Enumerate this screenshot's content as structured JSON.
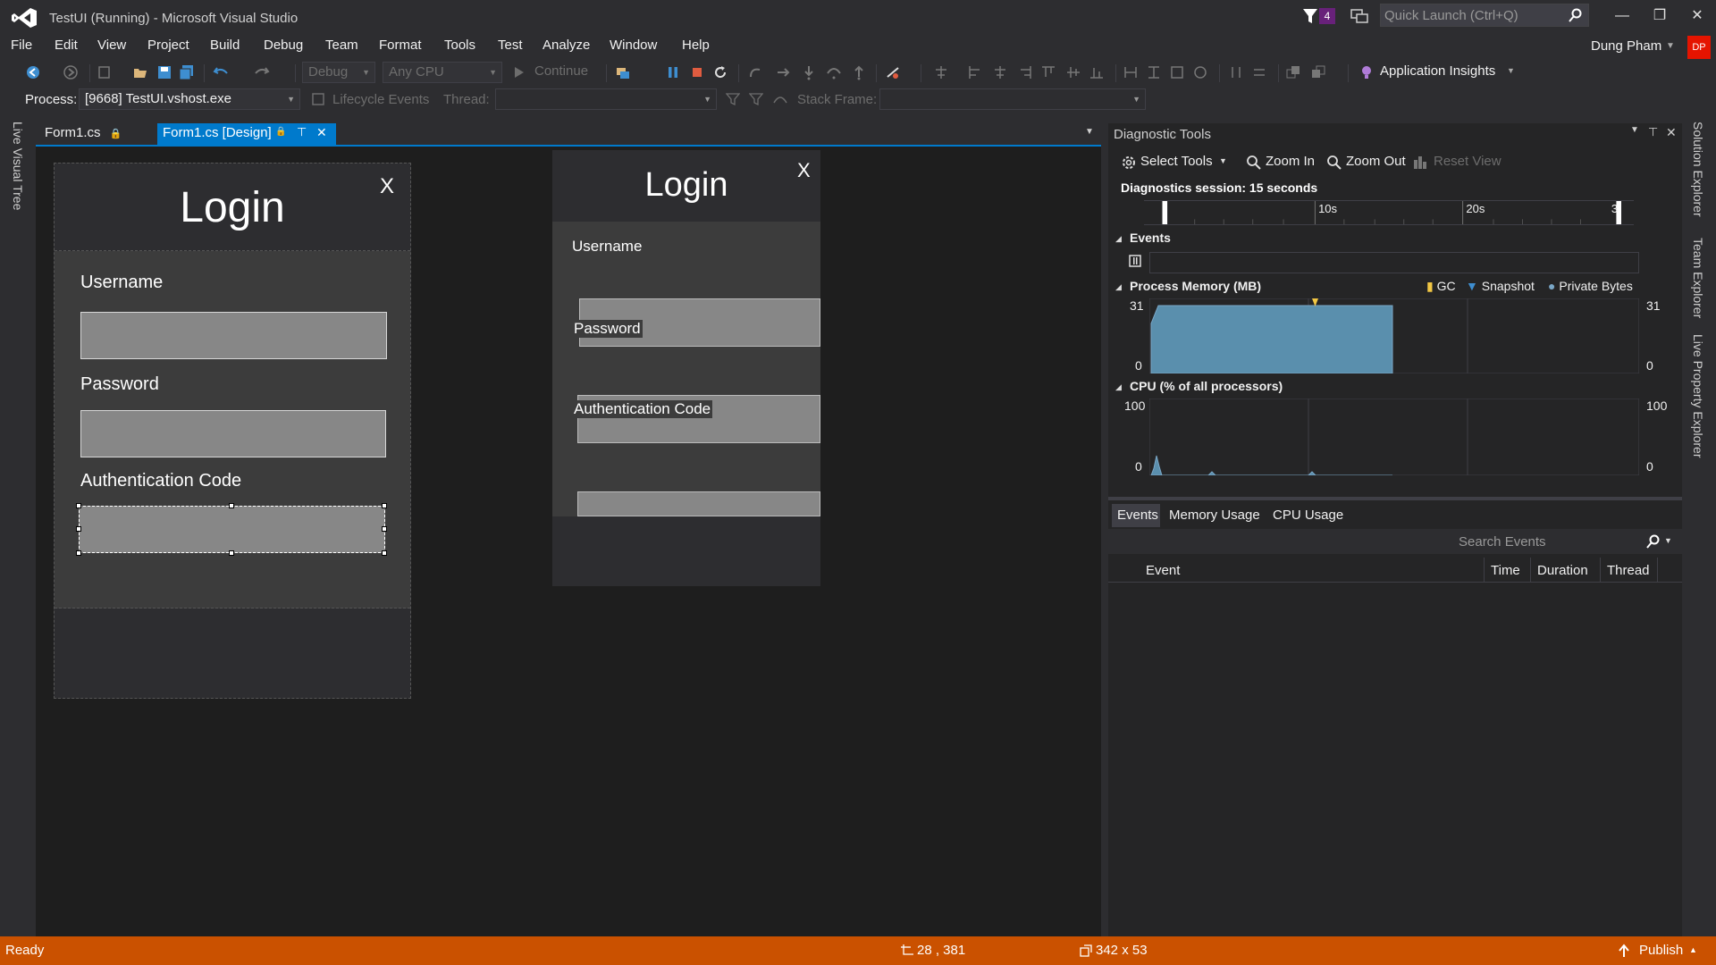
{
  "window": {
    "title": "TestUI (Running) - Microsoft Visual Studio",
    "notification_count": "4",
    "quick_launch_placeholder": "Quick Launch (Ctrl+Q)",
    "user_name": "Dung Pham",
    "user_initials": "DP"
  },
  "menu": [
    "File",
    "Edit",
    "View",
    "Project",
    "Build",
    "Debug",
    "Team",
    "Format",
    "Tools",
    "Test",
    "Analyze",
    "Window",
    "Help"
  ],
  "toolbar": {
    "configuration": "Debug",
    "platform": "Any CPU",
    "continue_label": "Continue",
    "app_insights_label": "Application Insights"
  },
  "process_bar": {
    "process_label": "Process:",
    "process_value": "[9668] TestUI.vshost.exe",
    "lifecycle_label": "Lifecycle Events",
    "thread_label": "Thread:",
    "stack_frame_label": "Stack Frame:"
  },
  "side_tabs": {
    "left": "Live Visual Tree",
    "right": [
      "Solution Explorer",
      "Team Explorer",
      "Live Property Explorer"
    ]
  },
  "tabs": {
    "form1cs": "Form1.cs",
    "form1design": "Form1.cs [Design]"
  },
  "design_form": {
    "title": "Login",
    "close": "X",
    "username_label": "Username",
    "password_label": "Password",
    "auth_label": "Authentication Code"
  },
  "running_form": {
    "title": "Login",
    "close": "X",
    "username_label": "Username",
    "password_label": "Password",
    "auth_label": "Authentication Code"
  },
  "diagnostic_tools": {
    "title": "Diagnostic Tools",
    "select_tools": "Select Tools",
    "zoom_in": "Zoom In",
    "zoom_out": "Zoom Out",
    "reset_view": "Reset View",
    "session": "Diagnostics session: 15 seconds",
    "timeline_ticks": [
      "10s",
      "20s",
      "3"
    ],
    "events_label": "Events",
    "memory_label": "Process Memory (MB)",
    "memory_legend": [
      "GC",
      "Snapshot",
      "Private Bytes"
    ],
    "memory_max": "31",
    "memory_min": "0",
    "cpu_label": "CPU (% of all processors)",
    "cpu_max": "100",
    "cpu_min": "0",
    "bottom_tabs": [
      "Events",
      "Memory Usage",
      "CPU Usage"
    ],
    "search_placeholder": "Search Events",
    "columns": [
      "Event",
      "Time",
      "Duration",
      "Thread"
    ]
  },
  "colors": {
    "accent": "#007acc",
    "status_bar": "#ca5100",
    "memory_fill": "#5a8fad",
    "gc_marker": "#f2c744"
  },
  "status_bar": {
    "ready": "Ready",
    "position": "28 , 381",
    "size": "342 x 53",
    "publish": "Publish"
  }
}
